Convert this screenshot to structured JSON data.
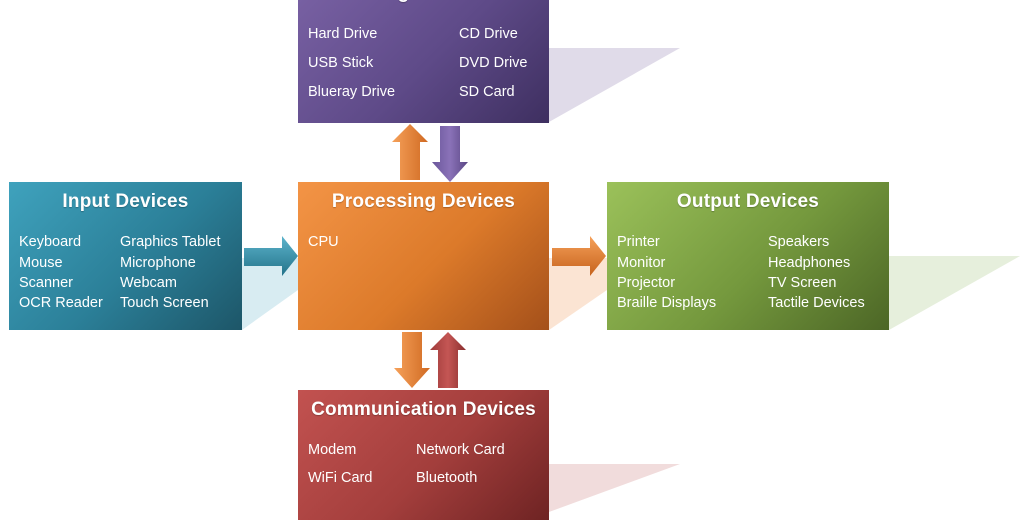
{
  "diagram": {
    "nodes": {
      "storage": {
        "title": "Storage Devices",
        "color": "#6a5494",
        "shadow_color": "#e0dbe9",
        "items": [
          "Hard Drive",
          "CD Drive",
          "USB Stick",
          "DVD Drive",
          "Blueray Drive",
          "SD Card"
        ]
      },
      "input": {
        "title": "Input Devices",
        "color": "#2f8aa4",
        "shadow_color": "#d8ecf2",
        "items": [
          "Keyboard",
          "Graphics Tablet",
          "Mouse",
          "Microphone",
          "Scanner",
          "Webcam",
          "OCR Reader",
          "Touch Screen"
        ]
      },
      "processing": {
        "title": "Processing Devices",
        "color": "#e07e2e",
        "shadow_color": "#fbe4d3",
        "items": [
          "CPU"
        ]
      },
      "output": {
        "title": "Output Devices",
        "color": "#7ea144",
        "shadow_color": "#e6efdc",
        "items": [
          "Printer",
          "Speakers",
          "Monitor",
          "Headphones",
          "Projector",
          "TV Screen",
          "Braille Displays",
          "Tactile Devices"
        ]
      },
      "comm": {
        "title": "Communication  Devices",
        "color": "#a84341",
        "shadow_color": "#f1dcdc",
        "items": [
          "Modem",
          "Network Card",
          "WiFi Card",
          "Bluetooth"
        ]
      }
    },
    "edges": [
      {
        "from": "input",
        "to": "processing",
        "color": "#2f8aa4"
      },
      {
        "from": "processing",
        "to": "output",
        "color": "#e07e2e"
      },
      {
        "from": "processing",
        "to": "storage",
        "color": "#e07e2e"
      },
      {
        "from": "storage",
        "to": "processing",
        "color": "#6a5494"
      },
      {
        "from": "processing",
        "to": "comm",
        "color": "#e07e2e"
      },
      {
        "from": "comm",
        "to": "processing",
        "color": "#a84341"
      }
    ]
  }
}
